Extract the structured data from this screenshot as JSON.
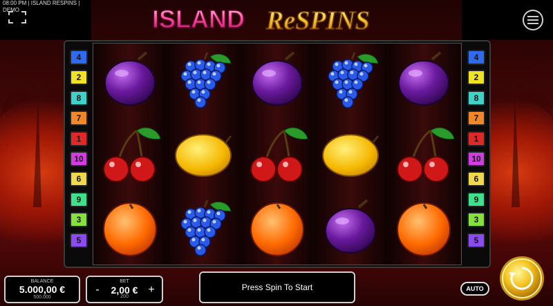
{
  "header": {
    "info_text": "08:00 PM | ISLAND RESPINS | DEMO",
    "title_word1": "ISLAND",
    "title_word2": "ReSPINS"
  },
  "paylines": {
    "left": [
      {
        "label": "4",
        "color": "#2f6bf0"
      },
      {
        "label": "2",
        "color": "#f0e224"
      },
      {
        "label": "8",
        "color": "#3fd2c8"
      },
      {
        "label": "7",
        "color": "#f0882a"
      },
      {
        "label": "1",
        "color": "#e02828"
      },
      {
        "label": "10",
        "color": "#d23ce0"
      },
      {
        "label": "6",
        "color": "#f0d84c"
      },
      {
        "label": "9",
        "color": "#3fe08c"
      },
      {
        "label": "3",
        "color": "#88e03c"
      },
      {
        "label": "5",
        "color": "#8a4cf0"
      }
    ],
    "right": [
      {
        "label": "4",
        "color": "#2f6bf0"
      },
      {
        "label": "2",
        "color": "#f0e224"
      },
      {
        "label": "8",
        "color": "#3fd2c8"
      },
      {
        "label": "7",
        "color": "#f0882a"
      },
      {
        "label": "1",
        "color": "#e02828"
      },
      {
        "label": "10",
        "color": "#d23ce0"
      },
      {
        "label": "6",
        "color": "#f0d84c"
      },
      {
        "label": "9",
        "color": "#3fe08c"
      },
      {
        "label": "3",
        "color": "#88e03c"
      },
      {
        "label": "5",
        "color": "#8a4cf0"
      }
    ]
  },
  "reels": [
    [
      "plum-icon",
      "cherry-icon",
      "orange-icon"
    ],
    [
      "grapes-icon",
      "lemon-icon",
      "grapes-icon"
    ],
    [
      "plum-icon",
      "cherry-icon",
      "orange-icon"
    ],
    [
      "grapes-icon",
      "lemon-icon",
      "plum-icon"
    ],
    [
      "plum-icon",
      "cherry-icon",
      "orange-icon"
    ]
  ],
  "balance": {
    "label": "BALANCE",
    "value": "5.000,00 €",
    "sub": "500.000"
  },
  "bet": {
    "label": "BET",
    "minus": "-",
    "value": "2,00 €",
    "plus": "+",
    "sub": "200"
  },
  "message": "Press Spin To Start",
  "auto_label": "AUTO",
  "icons": {
    "fullscreen": "fullscreen-icon",
    "menu": "menu-icon",
    "spin": "spin-icon"
  }
}
